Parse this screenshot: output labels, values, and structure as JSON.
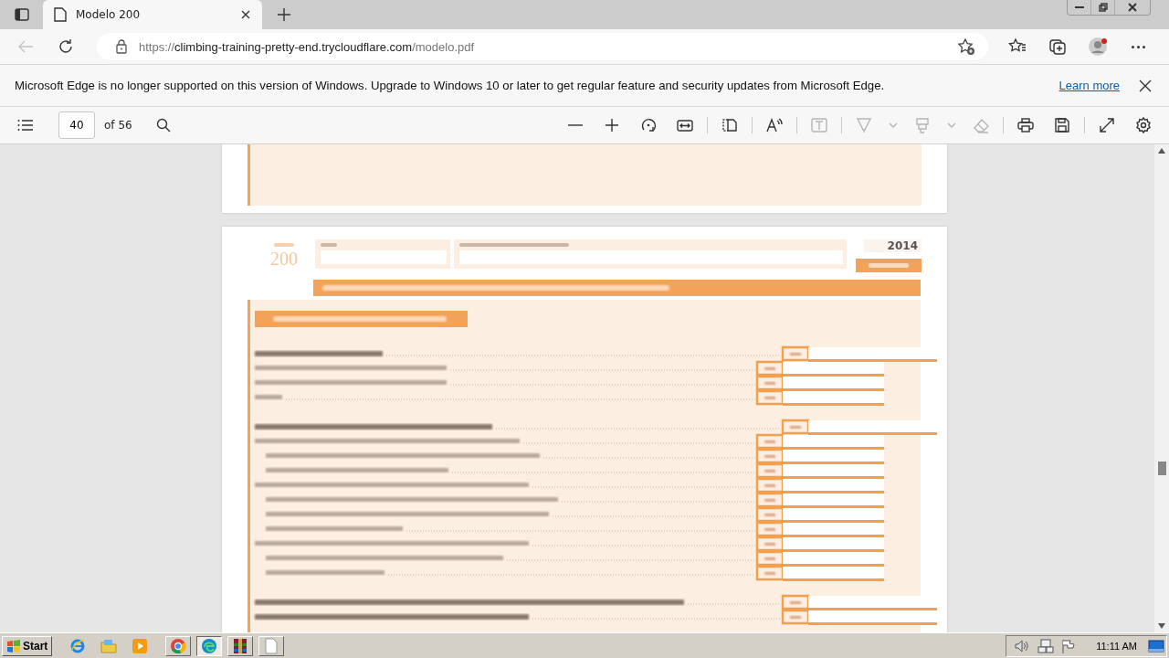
{
  "browser": {
    "tab": {
      "title": "Modelo 200",
      "selected": true
    },
    "address": {
      "origin": "https://",
      "host": "climbing-training-pretty-end.trycloudflare.com",
      "path": "/modelo.pdf"
    },
    "back_disabled": true
  },
  "infobar": {
    "message": "Microsoft Edge is no longer supported on this version of Windows. Upgrade to Windows 10 or later to get regular feature and security updates from Microsoft Edge.",
    "link": "Learn more"
  },
  "pdf_toolbar": {
    "page": "40",
    "page_count": "of 56",
    "tools": [
      {
        "kind": "zoom-out",
        "disabled": false
      },
      {
        "kind": "zoom-in",
        "disabled": false
      },
      {
        "kind": "rotate",
        "disabled": false
      },
      {
        "kind": "fit",
        "disabled": false
      },
      {
        "kind": "separator"
      },
      {
        "kind": "page-view",
        "disabled": false
      },
      {
        "kind": "separator"
      },
      {
        "kind": "read-aloud",
        "disabled": false
      },
      {
        "kind": "separator"
      },
      {
        "kind": "text",
        "disabled": true
      },
      {
        "kind": "separator"
      },
      {
        "kind": "draw",
        "disabled": true
      },
      {
        "kind": "chevron",
        "disabled": true
      },
      {
        "kind": "highlight",
        "disabled": true
      },
      {
        "kind": "chevron",
        "disabled": true
      },
      {
        "kind": "erase",
        "disabled": true
      },
      {
        "kind": "separator"
      },
      {
        "kind": "print",
        "disabled": false
      },
      {
        "kind": "save",
        "disabled": false
      },
      {
        "kind": "separator"
      },
      {
        "kind": "fullscreen",
        "disabled": false
      },
      {
        "kind": "settings",
        "disabled": false
      }
    ]
  },
  "document": {
    "model": "200",
    "year": "2014",
    "rows": [
      {
        "kind": "total"
      },
      {
        "kind": "item"
      },
      {
        "kind": "item"
      },
      {
        "kind": "item"
      },
      {
        "kind": "total"
      },
      {
        "kind": "item"
      },
      {
        "kind": "subitem"
      },
      {
        "kind": "subitem"
      },
      {
        "kind": "item"
      },
      {
        "kind": "subitem"
      },
      {
        "kind": "subitem"
      },
      {
        "kind": "subitem"
      },
      {
        "kind": "item"
      },
      {
        "kind": "subitem"
      },
      {
        "kind": "subitem"
      },
      {
        "kind": "total"
      },
      {
        "kind": "total"
      }
    ]
  },
  "taskbar": {
    "start": "Start",
    "items": [
      {
        "kind": "ie",
        "selected": false
      },
      {
        "kind": "explorer",
        "selected": false
      },
      {
        "kind": "media",
        "selected": false
      },
      {
        "kind": "chrome",
        "selected": false
      },
      {
        "kind": "edge",
        "selected": true
      },
      {
        "kind": "archive",
        "selected": false
      },
      {
        "kind": "blank",
        "selected": false
      }
    ],
    "clock": "11:11 AM"
  }
}
